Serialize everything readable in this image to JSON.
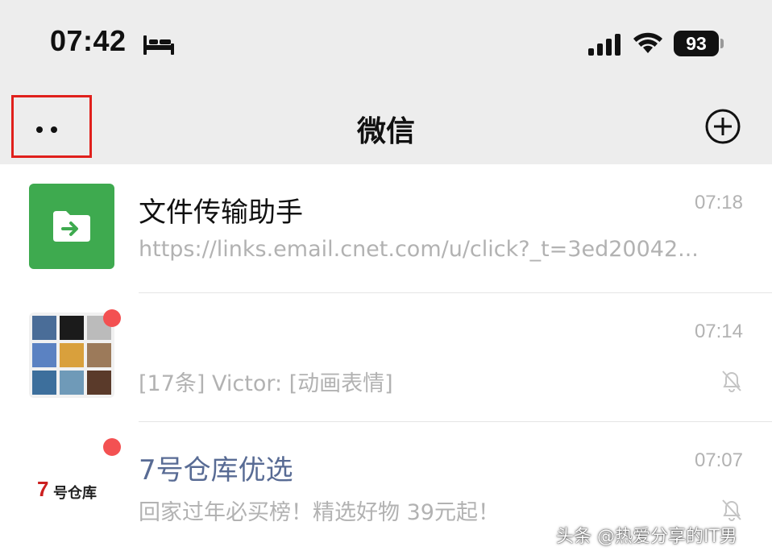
{
  "status_bar": {
    "time": "07:42",
    "battery": "93",
    "icons": [
      "bed-icon",
      "cellular-signal-icon",
      "wifi-icon",
      "battery-icon"
    ]
  },
  "nav": {
    "title": "微信",
    "more_icon": "more-dots-icon",
    "add_icon": "add-circle-icon",
    "highlight_color": "#e0201c"
  },
  "chats": [
    {
      "name": "文件传输助手",
      "preview": "https://links.email.cnet.com/u/click?_t=3ed20042...",
      "time": "07:18",
      "avatar": "file-transfer-icon",
      "avatar_color": "#3eaa4f"
    },
    {
      "name": "",
      "preview": "[17条] Victor: [动画表情]",
      "time": "07:14",
      "avatar": "group-avatar",
      "muted": true,
      "unread_dot": true
    },
    {
      "name": "7号仓库优选",
      "preview": "回家过年必买榜！精选好物 39元起！",
      "time": "07:07",
      "avatar": "brand-logo",
      "brand_number": "7",
      "brand_text": "号仓库",
      "muted": true,
      "unread_dot": true
    }
  ],
  "colors": {
    "header_bg": "#ededed",
    "badge": "#f35152",
    "official_name": "#586b94",
    "muted_text": "#b2b2b2"
  },
  "watermark": "头条 @热爱分享的IT男"
}
